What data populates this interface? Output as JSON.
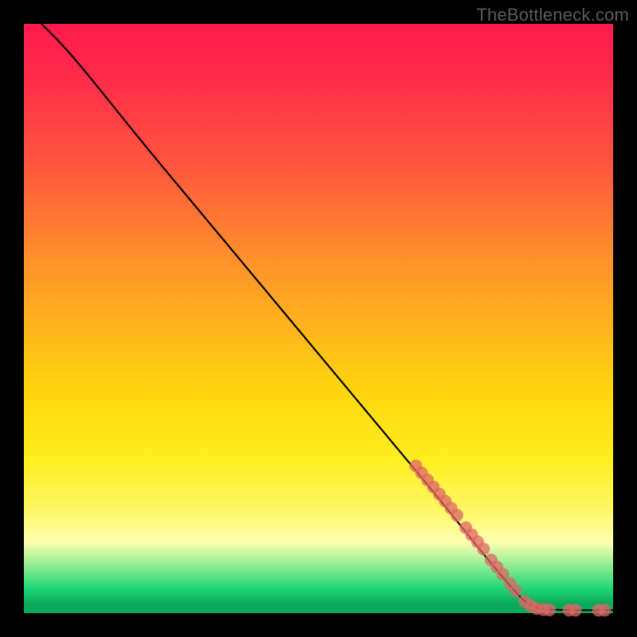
{
  "watermark": "TheBottleneck.com",
  "chart_data": {
    "type": "line",
    "title": "",
    "xlabel": "",
    "ylabel": "",
    "xlim": [
      0,
      100
    ],
    "ylim": [
      0,
      100
    ],
    "grid": false,
    "curve": {
      "name": "bottleneck-curve",
      "color": "#000000",
      "points": [
        {
          "x": 3,
          "y": 100
        },
        {
          "x": 7,
          "y": 96
        },
        {
          "x": 12,
          "y": 90
        },
        {
          "x": 20,
          "y": 80
        },
        {
          "x": 30,
          "y": 68
        },
        {
          "x": 40,
          "y": 56
        },
        {
          "x": 50,
          "y": 44
        },
        {
          "x": 60,
          "y": 32
        },
        {
          "x": 70,
          "y": 20
        },
        {
          "x": 78,
          "y": 10
        },
        {
          "x": 83,
          "y": 4
        },
        {
          "x": 86,
          "y": 1
        },
        {
          "x": 90,
          "y": 0.5
        },
        {
          "x": 100,
          "y": 0.5
        }
      ]
    },
    "markers": {
      "name": "highlight-segment",
      "color": "#e06666",
      "radius_px": 8,
      "points": [
        {
          "x": 66.5,
          "y": 25.0
        },
        {
          "x": 67.5,
          "y": 23.8
        },
        {
          "x": 68.5,
          "y": 22.6
        },
        {
          "x": 69.5,
          "y": 21.4
        },
        {
          "x": 70.5,
          "y": 20.2
        },
        {
          "x": 71.5,
          "y": 19.0
        },
        {
          "x": 72.5,
          "y": 17.8
        },
        {
          "x": 73.5,
          "y": 16.6
        },
        {
          "x": 75.0,
          "y": 14.5
        },
        {
          "x": 76.0,
          "y": 13.3
        },
        {
          "x": 77.0,
          "y": 12.1
        },
        {
          "x": 78.0,
          "y": 10.9
        },
        {
          "x": 79.3,
          "y": 9.0
        },
        {
          "x": 80.3,
          "y": 7.8
        },
        {
          "x": 81.3,
          "y": 6.6
        },
        {
          "x": 82.5,
          "y": 5.0
        },
        {
          "x": 83.5,
          "y": 3.8
        },
        {
          "x": 85.0,
          "y": 2.0
        },
        {
          "x": 86.0,
          "y": 1.2
        },
        {
          "x": 87.0,
          "y": 0.8
        },
        {
          "x": 88.2,
          "y": 0.6
        },
        {
          "x": 89.2,
          "y": 0.55
        },
        {
          "x": 92.5,
          "y": 0.5
        },
        {
          "x": 93.6,
          "y": 0.5
        },
        {
          "x": 97.5,
          "y": 0.5
        },
        {
          "x": 98.6,
          "y": 0.5
        }
      ]
    }
  }
}
